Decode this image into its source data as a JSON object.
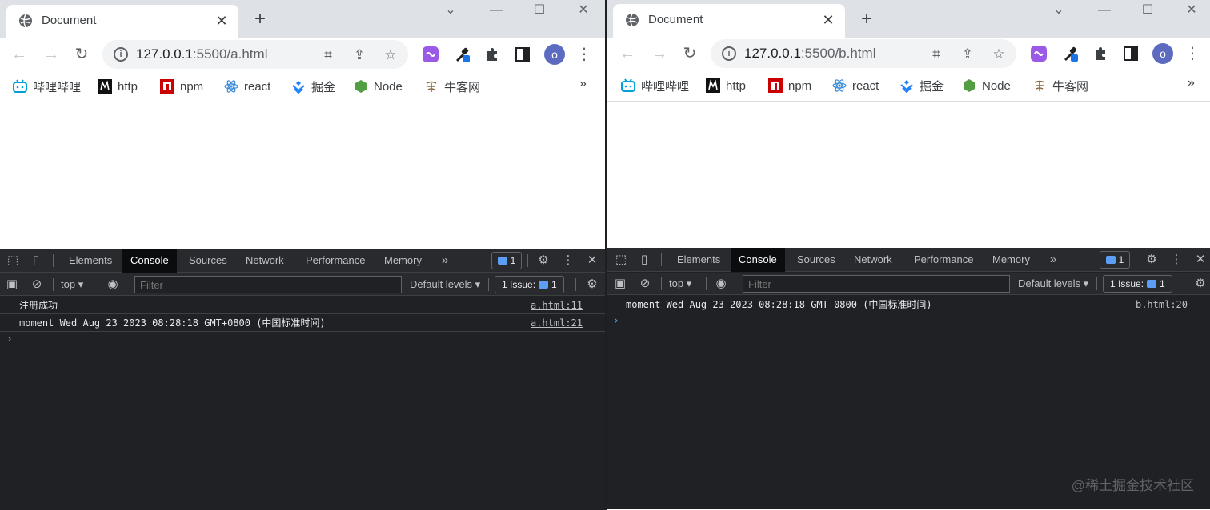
{
  "windows": [
    {
      "tab_title": "Document",
      "url_host": "127.0.0.1",
      "url_path": ":5500/a.html",
      "bookmarks": [
        "哔哩哔哩",
        "http",
        "npm",
        "react",
        "掘金",
        "Node",
        "牛客网"
      ],
      "devtools": {
        "tabs": [
          "Elements",
          "Console",
          "Sources",
          "Network",
          "Performance",
          "Memory"
        ],
        "active_tab": "Console",
        "messages_badge": "1",
        "context": "top",
        "filter_placeholder": "Filter",
        "levels": "Default levels",
        "issues_label": "1 Issue:",
        "issues_count": "1",
        "logs": [
          {
            "text": "注册成功",
            "source": "a.html:11"
          },
          {
            "text": "moment Wed Aug 23 2023 08:28:18 GMT+0800 (中国标准时间)",
            "source": "a.html:21"
          }
        ]
      }
    },
    {
      "tab_title": "Document",
      "url_host": "127.0.0.1",
      "url_path": ":5500/b.html",
      "bookmarks": [
        "哔哩哔哩",
        "http",
        "npm",
        "react",
        "掘金",
        "Node",
        "牛客网"
      ],
      "devtools": {
        "tabs": [
          "Elements",
          "Console",
          "Sources",
          "Network",
          "Performance",
          "Memory"
        ],
        "active_tab": "Console",
        "messages_badge": "1",
        "context": "top",
        "filter_placeholder": "Filter",
        "levels": "Default levels",
        "issues_label": "1 Issue:",
        "issues_count": "1",
        "logs": [
          {
            "text": "moment Wed Aug 23 2023 08:28:18 GMT+0800 (中国标准时间)",
            "source": "b.html:20"
          }
        ]
      }
    }
  ],
  "watermark": "@稀土掘金技术社区",
  "colors": {
    "tabstrip": "#dee1e6",
    "devtools_bg": "#202124",
    "accent_blue": "#5c9df5",
    "bilibili": "#00a1d6",
    "npm": "#cb0000",
    "react": "#3a8bd7",
    "juejin": "#1e80ff",
    "node": "#539e43"
  }
}
